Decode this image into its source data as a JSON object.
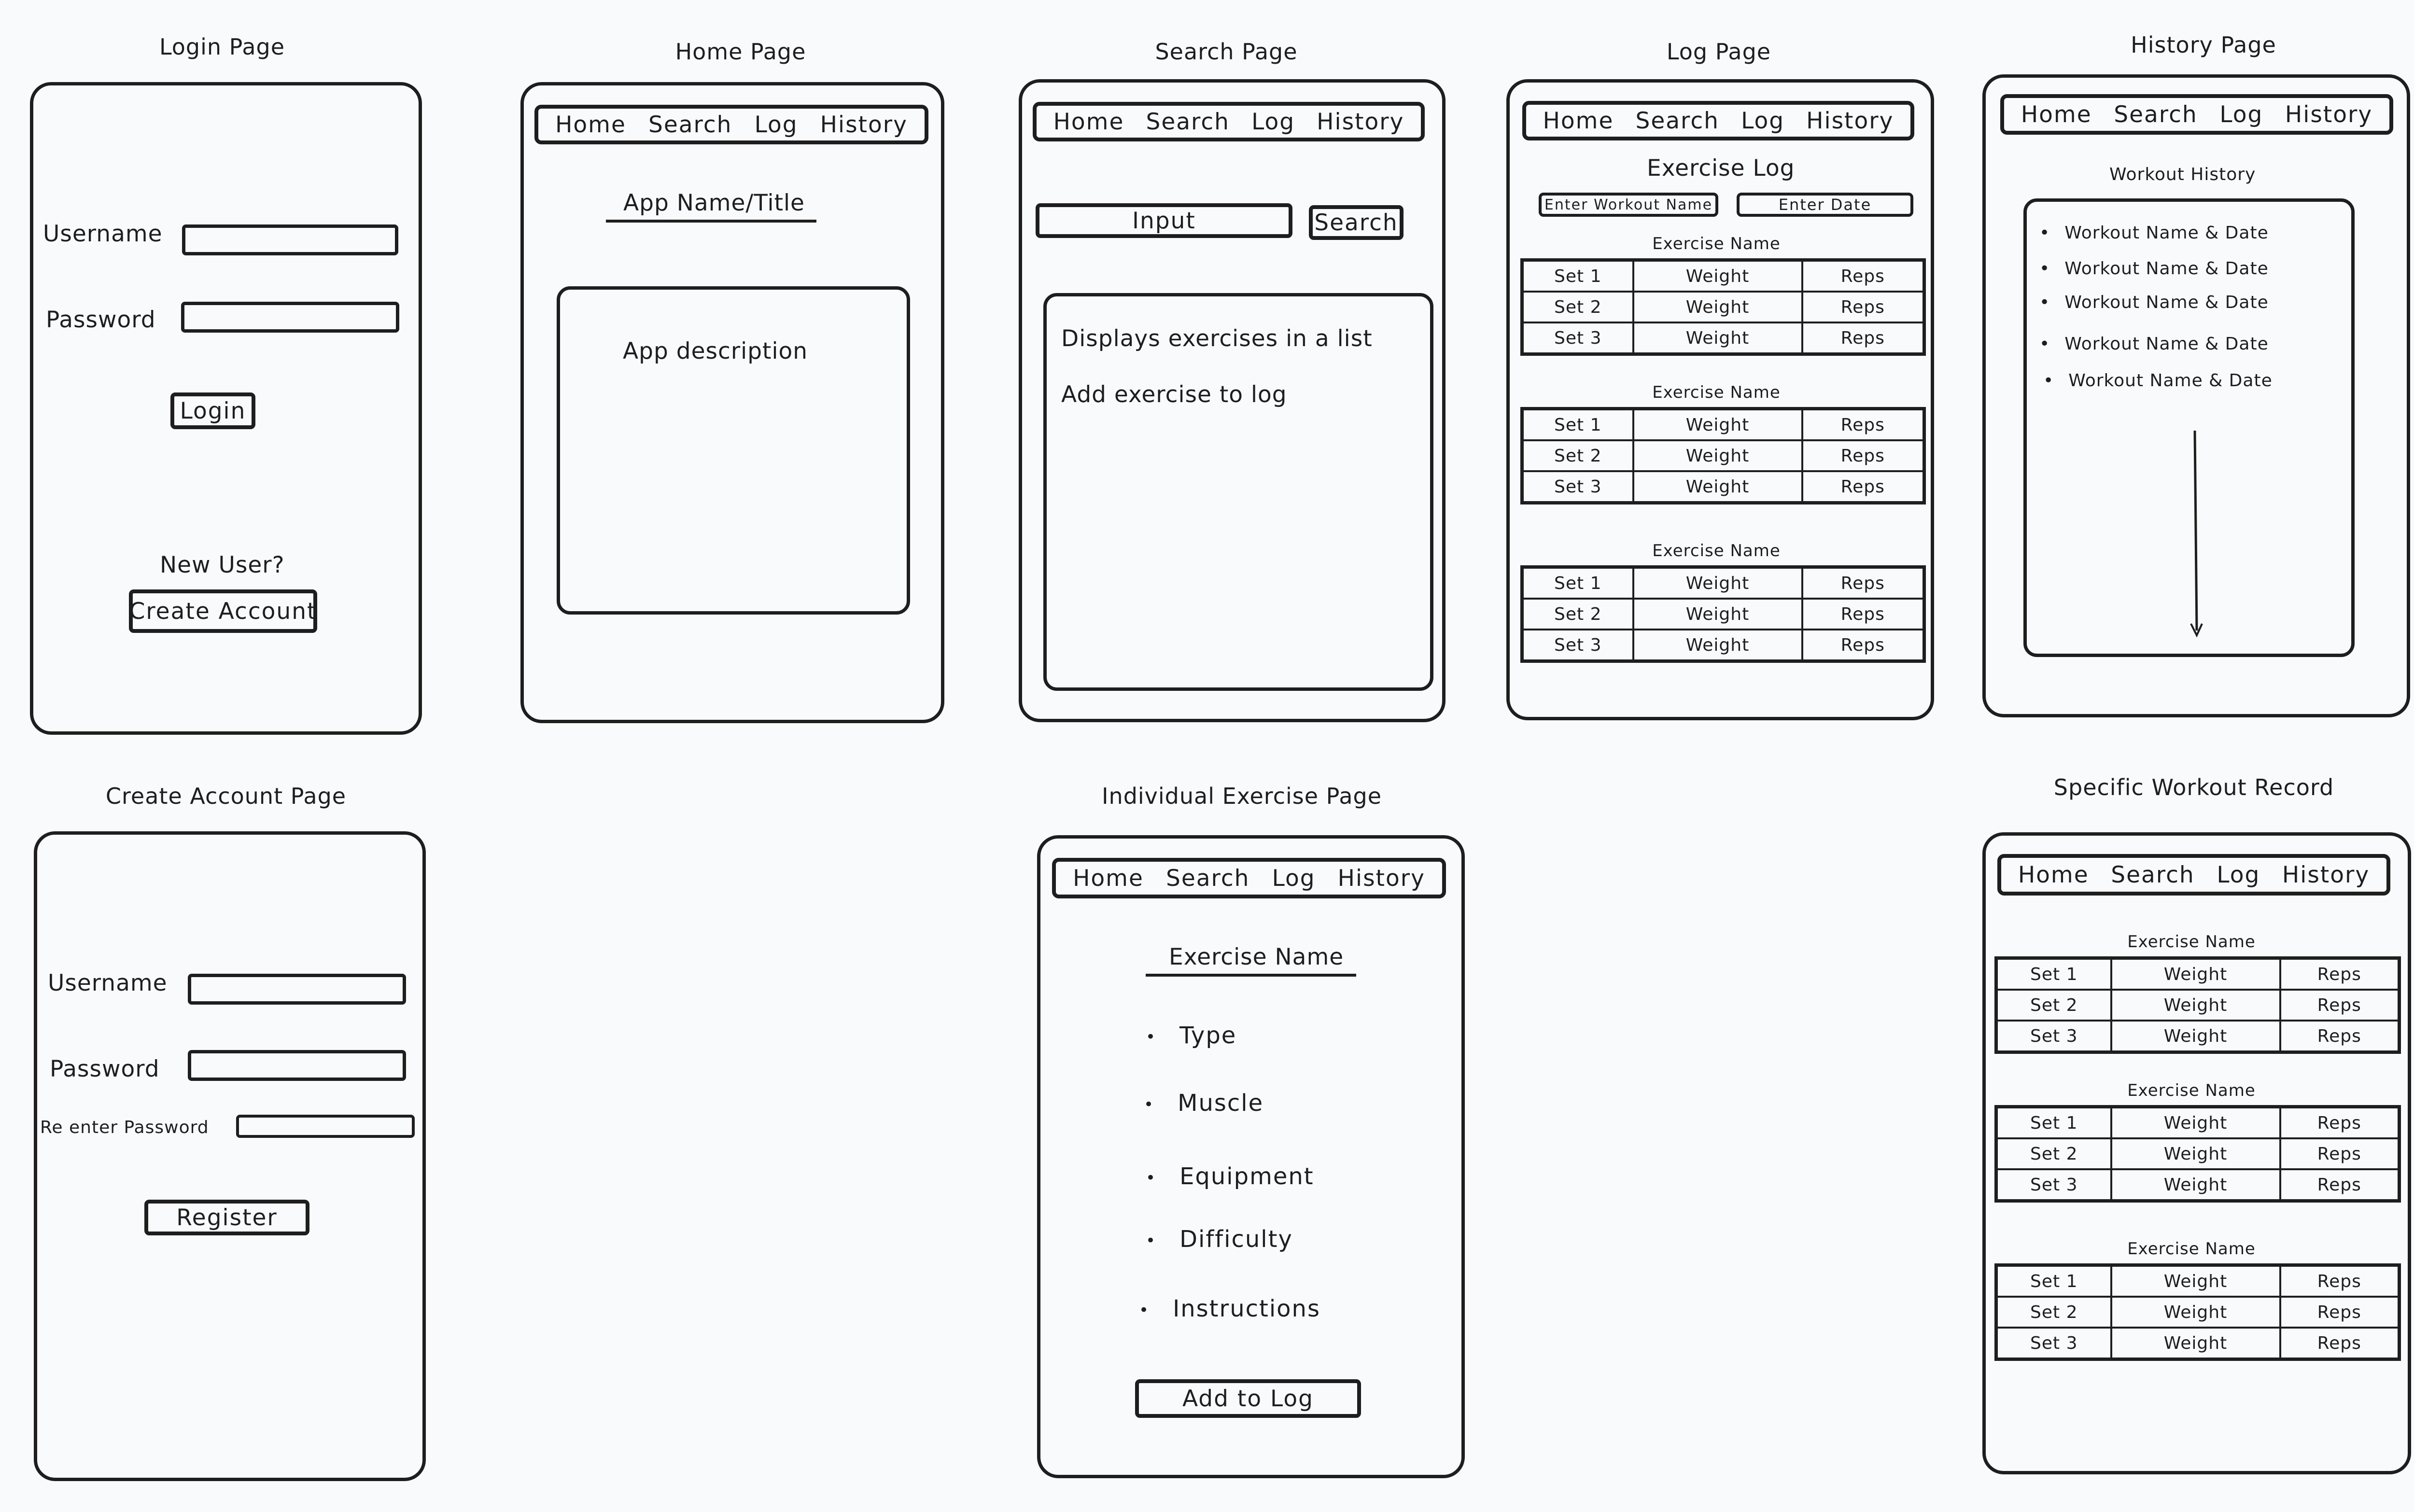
{
  "nav": [
    "Home",
    "Search",
    "Log",
    "History"
  ],
  "login": {
    "title": "Login Page",
    "username_label": "Username",
    "password_label": "Password",
    "login_button": "Login",
    "new_user": "New User?",
    "create_account_button": "Create Account"
  },
  "home": {
    "title": "Home Page",
    "app_name": "App Name/Title",
    "app_description": "App description"
  },
  "search": {
    "title": "Search Page",
    "input_label": "Input",
    "search_button": "Search",
    "list_line1": "Displays exercises in a list",
    "list_line2": "Add exercise to log"
  },
  "log": {
    "title": "Log Page",
    "heading": "Exercise Log",
    "workout_name_placeholder": "Enter Workout Name",
    "date_placeholder": "Enter Date"
  },
  "history": {
    "title": "History Page",
    "heading": "Workout History",
    "items": [
      "Workout Name & Date",
      "Workout Name & Date",
      "Workout Name & Date",
      "Workout Name & Date",
      "Workout Name & Date"
    ]
  },
  "create_account": {
    "title": "Create Account Page",
    "username_label": "Username",
    "password_label": "Password",
    "reenter_label": "Re enter Password",
    "register_button": "Register"
  },
  "exercise": {
    "title": "Individual Exercise Page",
    "name": "Exercise Name",
    "attributes": [
      "Type",
      "Muscle",
      "Equipment",
      "Difficulty",
      "Instructions"
    ],
    "add_button": "Add to Log"
  },
  "record": {
    "title": "Specific Workout Record"
  },
  "exercise_block": {
    "name": "Exercise Name",
    "rows": [
      [
        "Set 1",
        "Weight",
        "Reps"
      ],
      [
        "Set 2",
        "Weight",
        "Reps"
      ],
      [
        "Set 3",
        "Weight",
        "Reps"
      ]
    ]
  }
}
